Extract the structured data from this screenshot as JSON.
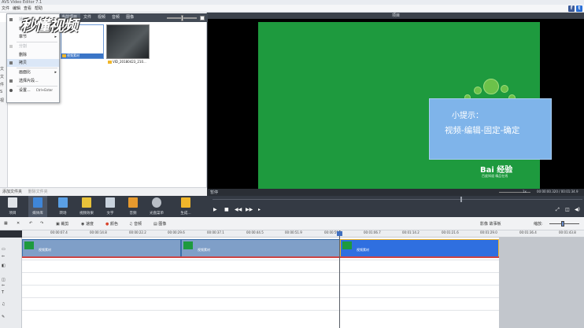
{
  "title": "AVS Video Editor 7.1",
  "menu": [
    "文件",
    "编辑",
    "查看",
    "帮助"
  ],
  "left_tabs": [
    "当前项目",
    "文件",
    "视频",
    "音频",
    "图像"
  ],
  "media_items": [
    {
      "name": "视频素材"
    },
    {
      "name": "VID_20180423_210..."
    }
  ],
  "folder_labels": [
    "文",
    "文",
    "件",
    "S",
    "视"
  ],
  "left_footer": [
    "添加文件夹",
    "删除文件夹"
  ],
  "context_menu": [
    {
      "label": "播放",
      "enabled": false,
      "submenu": false
    },
    {
      "label": "轨",
      "enabled": true,
      "submenu": true
    },
    {
      "label": "章节",
      "enabled": true,
      "submenu": true
    },
    {
      "label": "分割",
      "enabled": false,
      "submenu": false
    },
    {
      "label": "删除",
      "enabled": true,
      "submenu": false
    },
    {
      "label": "拷贝",
      "enabled": true,
      "submenu": false
    },
    {
      "label": "画面比",
      "enabled": true,
      "submenu": true
    },
    {
      "label": "选择片段...",
      "enabled": true,
      "submenu": false
    },
    {
      "label": "设置...",
      "enabled": true,
      "submenu": false,
      "shortcut": "Ctrl+Enter"
    }
  ],
  "watermark": "秒懂视频",
  "preview": {
    "header": "项目",
    "tip_title": "小提示：",
    "tip_body": "视频-编辑-固定-确定",
    "brand": "Bai 经验",
    "brand_sub": "百度知道 精品在线",
    "status_left": "暂停",
    "speed": "1x",
    "time": "00:00:00.320 / 00:01:34.9"
  },
  "toolbar": [
    "项目",
    "媒体库",
    "转场",
    "视频效果",
    "文字",
    "音频",
    "光盘菜单",
    "生成..."
  ],
  "timeline_tools": [
    "裁剪",
    "速度",
    "颜色",
    "音频",
    "图像"
  ],
  "timeline_right": [
    "影像 故事板",
    "缩放:"
  ],
  "ruler_ticks": [
    "00:00:07.4",
    "00:00:14.8",
    "00:00:22.2",
    "00:00:29.6",
    "00:00:37.1",
    "00:00:44.5",
    "00:00:51.9",
    "00:00:59.3",
    "00:01:06.7",
    "00:01:14.2",
    "00:01:21.6",
    "00:01:29.0",
    "00:01:36.4",
    "00:01:43.8"
  ],
  "clips": [
    "视频素材",
    "视频素材",
    "视频素材"
  ],
  "colors": {
    "panel_dark": "#343a44",
    "preview_green": "#1e9a3e",
    "tip_blue": "#7fb4ea",
    "clip_active": "#2f6fe0",
    "clip_normal": "#7f9fc8"
  }
}
